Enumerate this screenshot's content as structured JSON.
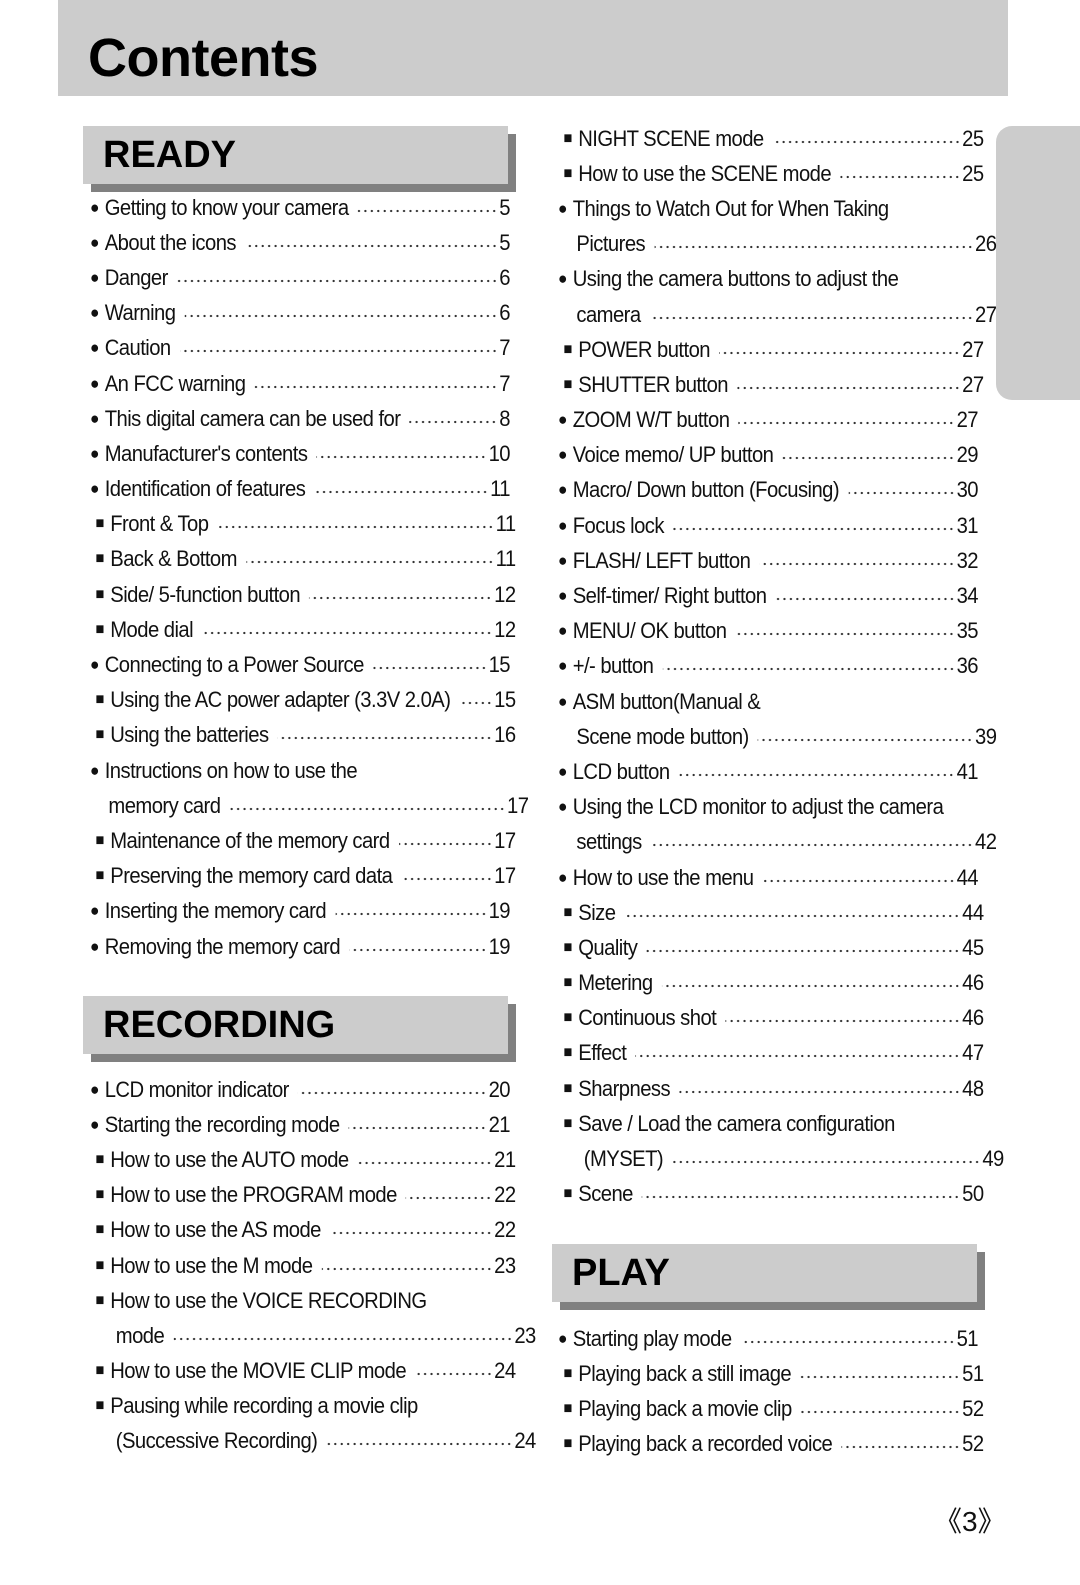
{
  "title": "Contents",
  "page_number": "《3》",
  "sections": {
    "ready": {
      "label": "READY",
      "items": [
        {
          "marker": "●",
          "text": "Getting to know your camera",
          "page": "5"
        },
        {
          "marker": "●",
          "text": "About the icons",
          "page": "5"
        },
        {
          "marker": "●",
          "text": "Danger",
          "page": "6"
        },
        {
          "marker": "●",
          "text": "Warning",
          "page": "6"
        },
        {
          "marker": "●",
          "text": "Caution",
          "page": "7"
        },
        {
          "marker": "●",
          "text": "An FCC warning",
          "page": "7"
        },
        {
          "marker": "●",
          "text": "This digital camera can be used for",
          "page": "8"
        },
        {
          "marker": "●",
          "text": "Manufacturer's contents",
          "page": "10"
        },
        {
          "marker": "●",
          "text": "Identification of features",
          "page": "11"
        },
        {
          "marker": "■",
          "text": "Front & Top",
          "page": "11"
        },
        {
          "marker": "■",
          "text": "Back & Bottom",
          "page": "11"
        },
        {
          "marker": "■",
          "text": "Side/ 5-function button",
          "page": "12"
        },
        {
          "marker": "■",
          "text": "Mode dial",
          "page": "12"
        },
        {
          "marker": "●",
          "text": "Connecting to a Power Source",
          "page": "15"
        },
        {
          "marker": "■",
          "text": "Using the AC power adapter (3.3V 2.0A)",
          "page": "15"
        },
        {
          "marker": "■",
          "text": "Using the batteries",
          "page": "16"
        },
        {
          "marker": "●",
          "text": "Instructions on how to use the",
          "continuation": "memory card",
          "page": "17"
        },
        {
          "marker": "■",
          "text": "Maintenance of the memory card",
          "page": "17"
        },
        {
          "marker": "■",
          "text": "Preserving the memory card data",
          "page": "17"
        },
        {
          "marker": "●",
          "text": "Inserting the memory card",
          "page": "19"
        },
        {
          "marker": "●",
          "text": "Removing the memory card",
          "page": "19"
        }
      ]
    },
    "recording": {
      "label": "RECORDING",
      "items": [
        {
          "marker": "●",
          "text": "LCD monitor indicator",
          "page": "20"
        },
        {
          "marker": "●",
          "text": "Starting the recording mode",
          "page": "21"
        },
        {
          "marker": "■",
          "text": "How to use the AUTO mode",
          "page": "21"
        },
        {
          "marker": "■",
          "text": "How to use the PROGRAM mode",
          "page": "22"
        },
        {
          "marker": "■",
          "text": "How to use the AS mode",
          "page": "22"
        },
        {
          "marker": "■",
          "text": "How to use the M mode",
          "page": "23"
        },
        {
          "marker": "■",
          "text": "How to use the VOICE RECORDING",
          "continuation": "mode",
          "page": "23"
        },
        {
          "marker": "■",
          "text": "How to use the MOVIE CLIP mode",
          "page": "24"
        },
        {
          "marker": "■",
          "text": "Pausing while recording a movie clip",
          "continuation": "(Successive Recording)",
          "page": "24"
        }
      ],
      "continued_items": [
        {
          "marker": "■",
          "text": "NIGHT SCENE mode",
          "page": "25"
        },
        {
          "marker": "■",
          "text": "How to use the SCENE mode",
          "page": "25"
        },
        {
          "marker": "●",
          "text": "Things to Watch Out for When Taking",
          "continuation": "Pictures",
          "page": "26"
        },
        {
          "marker": "●",
          "text": "Using the camera buttons to adjust the",
          "continuation": "camera",
          "page": "27"
        },
        {
          "marker": "■",
          "text": "POWER button",
          "page": "27"
        },
        {
          "marker": "■",
          "text": "SHUTTER button",
          "page": "27"
        },
        {
          "marker": "●",
          "text": "ZOOM W/T button",
          "page": "27"
        },
        {
          "marker": "●",
          "text": "Voice memo/ UP button",
          "page": "29"
        },
        {
          "marker": "●",
          "text": "Macro/ Down button (Focusing)",
          "page": "30"
        },
        {
          "marker": "●",
          "text": "Focus lock",
          "page": "31"
        },
        {
          "marker": "●",
          "text": "FLASH/ LEFT button",
          "page": "32"
        },
        {
          "marker": "●",
          "text": "Self-timer/ Right button",
          "page": "34"
        },
        {
          "marker": "●",
          "text": "MENU/ OK button",
          "page": "35"
        },
        {
          "marker": "●",
          "text": "+/- button",
          "page": "36"
        },
        {
          "marker": "●",
          "text": "ASM button(Manual &",
          "continuation": "Scene mode button)",
          "page": "39"
        },
        {
          "marker": "●",
          "text": "LCD button",
          "page": "41"
        },
        {
          "marker": "●",
          "text": "Using the LCD monitor to adjust the camera",
          "continuation": "settings",
          "page": "42"
        },
        {
          "marker": "●",
          "text": "How to use the menu",
          "page": "44"
        },
        {
          "marker": "■",
          "text": "Size",
          "page": "44"
        },
        {
          "marker": "■",
          "text": "Quality",
          "page": "45"
        },
        {
          "marker": "■",
          "text": "Metering",
          "page": "46"
        },
        {
          "marker": "■",
          "text": "Continuous shot",
          "page": "46"
        },
        {
          "marker": "■",
          "text": "Effect",
          "page": "47"
        },
        {
          "marker": "■",
          "text": "Sharpness",
          "page": "48"
        },
        {
          "marker": "■",
          "text": "Save / Load the camera configuration",
          "continuation": "(MYSET)",
          "page": "49"
        },
        {
          "marker": "■",
          "text": "Scene",
          "page": "50"
        }
      ]
    },
    "play": {
      "label": "PLAY",
      "items": [
        {
          "marker": "●",
          "text": "Starting play mode",
          "page": "51"
        },
        {
          "marker": "■",
          "text": "Playing back a still image",
          "page": "51"
        },
        {
          "marker": "■",
          "text": "Playing back a movie clip",
          "page": "52"
        },
        {
          "marker": "■",
          "text": "Playing back a recorded voice",
          "page": "52"
        }
      ]
    }
  }
}
